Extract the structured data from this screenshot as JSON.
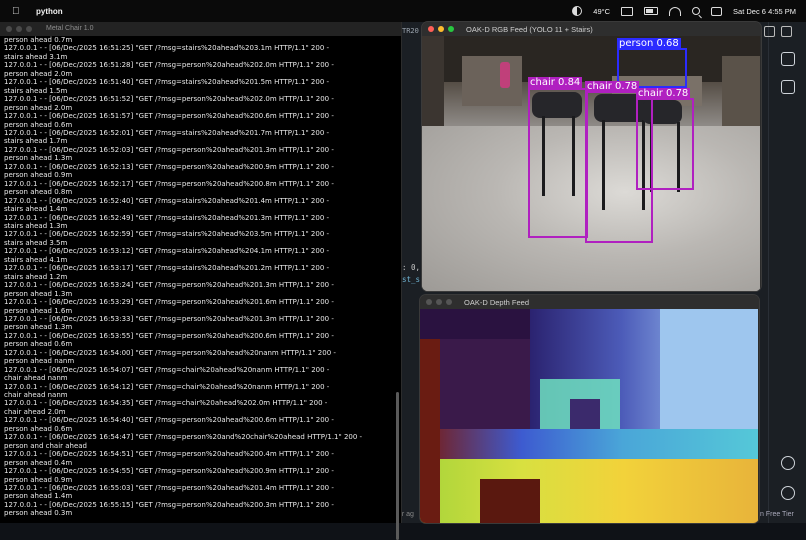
{
  "menubar": {
    "app_name": "python",
    "temperature": "49°C",
    "datetime": "Sat Dec 6  4:55 PM"
  },
  "terminal": {
    "title": "Metal Chair 1.0",
    "lines": [
      "person ahead 0.7m",
      "127.0.0.1 - - [06/Dec/2025 16:51:25] \"GET /?msg=stairs%20ahead%203.1m HTTP/1.1\" 200 -",
      "stairs ahead 3.1m",
      "127.0.0.1 - - [06/Dec/2025 16:51:28] \"GET /?msg=person%20ahead%202.0m HTTP/1.1\" 200 -",
      "person ahead 2.0m",
      "127.0.0.1 - - [06/Dec/2025 16:51:40] \"GET /?msg=stairs%20ahead%201.5m HTTP/1.1\" 200 -",
      "stairs ahead 1.5m",
      "127.0.0.1 - - [06/Dec/2025 16:51:52] \"GET /?msg=person%20ahead%202.0m HTTP/1.1\" 200 -",
      "person ahead 2.0m",
      "127.0.0.1 - - [06/Dec/2025 16:51:57] \"GET /?msg=person%20ahead%200.6m HTTP/1.1\" 200 -",
      "person ahead 0.6m",
      "127.0.0.1 - - [06/Dec/2025 16:52:01] \"GET /?msg=stairs%20ahead%201.7m HTTP/1.1\" 200 -",
      "stairs ahead 1.7m",
      "127.0.0.1 - - [06/Dec/2025 16:52:03] \"GET /?msg=person%20ahead%201.3m HTTP/1.1\" 200 -",
      "person ahead 1.3m",
      "127.0.0.1 - - [06/Dec/2025 16:52:13] \"GET /?msg=person%20ahead%200.9m HTTP/1.1\" 200 -",
      "person ahead 0.9m",
      "127.0.0.1 - - [06/Dec/2025 16:52:17] \"GET /?msg=person%20ahead%200.8m HTTP/1.1\" 200 -",
      "person ahead 0.8m",
      "127.0.0.1 - - [06/Dec/2025 16:52:40] \"GET /?msg=stairs%20ahead%201.4m HTTP/1.1\" 200 -",
      "stairs ahead 1.4m",
      "127.0.0.1 - - [06/Dec/2025 16:52:49] \"GET /?msg=stairs%20ahead%201.3m HTTP/1.1\" 200 -",
      "stairs ahead 1.3m",
      "127.0.0.1 - - [06/Dec/2025 16:52:59] \"GET /?msg=stairs%20ahead%203.5m HTTP/1.1\" 200 -",
      "stairs ahead 3.5m",
      "127.0.0.1 - - [06/Dec/2025 16:53:12] \"GET /?msg=stairs%20ahead%204.1m HTTP/1.1\" 200 -",
      "stairs ahead 4.1m",
      "127.0.0.1 - - [06/Dec/2025 16:53:17] \"GET /?msg=stairs%20ahead%201.2m HTTP/1.1\" 200 -",
      "stairs ahead 1.2m",
      "127.0.0.1 - - [06/Dec/2025 16:53:24] \"GET /?msg=person%20ahead%201.3m HTTP/1.1\" 200 -",
      "person ahead 1.3m",
      "127.0.0.1 - - [06/Dec/2025 16:53:29] \"GET /?msg=person%20ahead%201.6m HTTP/1.1\" 200 -",
      "person ahead 1.6m",
      "127.0.0.1 - - [06/Dec/2025 16:53:33] \"GET /?msg=person%20ahead%201.3m HTTP/1.1\" 200 -",
      "person ahead 1.3m",
      "127.0.0.1 - - [06/Dec/2025 16:53:55] \"GET /?msg=person%20ahead%200.6m HTTP/1.1\" 200 -",
      "person ahead 0.6m",
      "127.0.0.1 - - [06/Dec/2025 16:54:00] \"GET /?msg=person%20ahead%20nanm HTTP/1.1\" 200 -",
      "person ahead nanm",
      "127.0.0.1 - - [06/Dec/2025 16:54:07] \"GET /?msg=chair%20ahead%20nanm HTTP/1.1\" 200 -",
      "chair ahead nanm",
      "127.0.0.1 - - [06/Dec/2025 16:54:12] \"GET /?msg=chair%20ahead%20nanm HTTP/1.1\" 200 -",
      "chair ahead nanm",
      "127.0.0.1 - - [06/Dec/2025 16:54:35] \"GET /?msg=chair%20ahead%202.0m HTTP/1.1\" 200 -",
      "chair ahead 2.0m",
      "127.0.0.1 - - [06/Dec/2025 16:54:40] \"GET /?msg=person%20ahead%200.6m HTTP/1.1\" 200 -",
      "person ahead 0.6m",
      "127.0.0.1 - - [06/Dec/2025 16:54:47] \"GET /?msg=person%20and%20chair%20ahead HTTP/1.1\" 200 -",
      "person and chair ahead",
      "127.0.0.1 - - [06/Dec/2025 16:54:51] \"GET /?msg=person%20ahead%200.4m HTTP/1.1\" 200 -",
      "person ahead 0.4m",
      "127.0.0.1 - - [06/Dec/2025 16:54:55] \"GET /?msg=person%20ahead%200.9m HTTP/1.1\" 200 -",
      "person ahead 0.9m",
      "127.0.0.1 - - [06/Dec/2025 16:55:03] \"GET /?msg=person%20ahead%201.4m HTTP/1.1\" 200 -",
      "person ahead 1.4m",
      "127.0.0.1 - - [06/Dec/2025 16:55:15] \"GET /?msg=person%20ahead%200.3m HTTP/1.1\" 200 -",
      "person ahead 0.3m"
    ]
  },
  "rgb_window": {
    "title": "OAK-D RGB Feed (YOLO 11 + Stairs)",
    "detections": [
      {
        "label": "person 0.68",
        "color": "#2b2bff"
      },
      {
        "label": "chair 0.84",
        "color": "#b020c0"
      },
      {
        "label": "chair 0.78",
        "color": "#b020c0"
      },
      {
        "label": "chair 0.78",
        "color": "#b020c0"
      }
    ]
  },
  "depth_window": {
    "title": "OAK-D Depth Feed"
  },
  "editor": {
    "tab_fragment": "TR20",
    "code_fragment_1": ": 0,",
    "code_fragment_2": "st_s",
    "status_left": "ur ag",
    "status_right": "n Free Tier"
  }
}
